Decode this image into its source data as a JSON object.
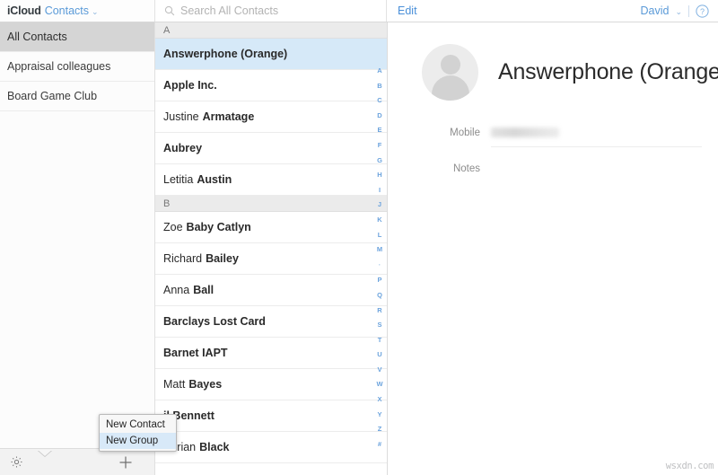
{
  "topbar": {
    "brand_service": "iCloud",
    "brand_app": "Contacts",
    "brand_caret": "⌄",
    "search_placeholder": "Search All Contacts",
    "edit_label": "Edit",
    "account_name": "David",
    "account_caret": "⌄",
    "help_icon": "question-circle-icon",
    "search_icon": "search-icon"
  },
  "sidebar": {
    "groups": [
      {
        "label": "All Contacts",
        "selected": true
      },
      {
        "label": "Appraisal colleagues",
        "selected": false
      },
      {
        "label": "Board Game Club",
        "selected": false
      }
    ],
    "footer": {
      "settings_icon": "gear-icon",
      "add_icon": "plus-icon"
    },
    "popup": {
      "items": [
        {
          "label": "New Contact",
          "active": false
        },
        {
          "label": "New Group",
          "active": true
        }
      ]
    }
  },
  "contact_list": {
    "sections": [
      {
        "letter": "A",
        "contacts": [
          {
            "first": "",
            "last": "Answerphone (Orange)",
            "selected": true
          },
          {
            "first": "",
            "last": "Apple Inc.",
            "selected": false
          },
          {
            "first": "Justine",
            "last": "Armatage",
            "selected": false
          },
          {
            "first": "",
            "last": "Aubrey",
            "selected": false
          },
          {
            "first": "Letitia",
            "last": "Austin",
            "selected": false
          }
        ]
      },
      {
        "letter": "B",
        "contacts": [
          {
            "first": "Zoe",
            "last": "Baby Catlyn",
            "selected": false
          },
          {
            "first": "Richard",
            "last": "Bailey",
            "selected": false
          },
          {
            "first": "Anna",
            "last": "Ball",
            "selected": false
          },
          {
            "first": "",
            "last": "Barclays Lost Card",
            "selected": false
          },
          {
            "first": "",
            "last": "Barnet IAPT",
            "selected": false
          },
          {
            "first": "Matt",
            "last": "Bayes",
            "selected": false
          },
          {
            "first": "",
            "last": "il Bennett",
            "selected": false
          },
          {
            "first": "Adrian",
            "last": "Black",
            "selected": false
          }
        ]
      }
    ],
    "alpha_index": [
      "A",
      "B",
      "C",
      "D",
      "E",
      "F",
      "G",
      "H",
      "I",
      "J",
      "K",
      "L",
      "M",
      "·",
      "P",
      "Q",
      "R",
      "S",
      "T",
      "U",
      "V",
      "W",
      "X",
      "Y",
      "Z",
      "#"
    ]
  },
  "detail": {
    "avatar_icon": "person-placeholder-icon",
    "name": "Answerphone (Orange)",
    "fields": [
      {
        "label": "Mobile",
        "value": "",
        "blurred": true
      },
      {
        "label": "Notes",
        "value": "",
        "blurred": false
      }
    ]
  },
  "watermark": "wsxdn.com",
  "colors": {
    "accent_blue": "#4a90d9",
    "selected_row": "#d6e9f8",
    "sidebar_selected": "#d5d5d5",
    "section_header": "#ebebeb"
  }
}
